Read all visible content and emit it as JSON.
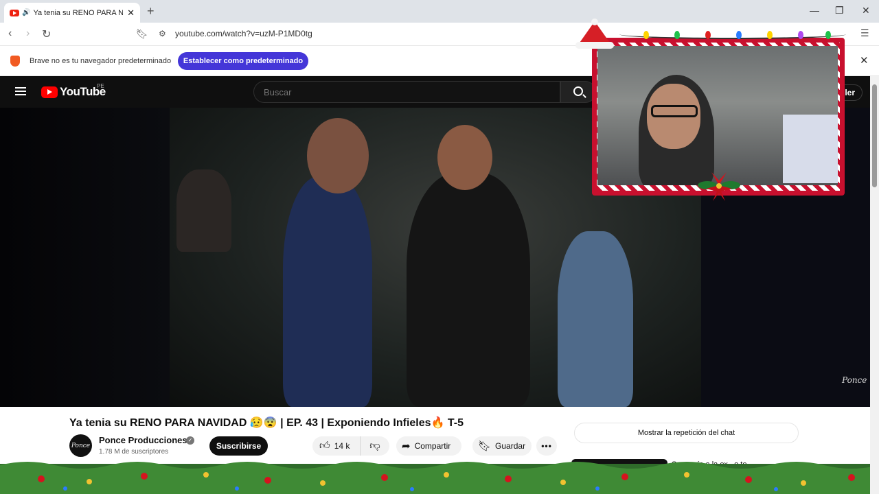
{
  "browser": {
    "tab_title": "Ya tenia su RENO PARA NAVII",
    "url": "youtube.com/watch?v=uzM-P1MD0tg",
    "new_tab_label": "+",
    "controls": {
      "minimize": "—",
      "restore": "❐",
      "close": "✕"
    }
  },
  "infobar": {
    "message": "Brave no es tu navegador predeterminado",
    "button_label": "Establecer como predeterminado",
    "close_label": "✕"
  },
  "youtube": {
    "logo_text": "YouTube",
    "region": "PE",
    "search_placeholder": "Buscar",
    "signin_partial": "ler"
  },
  "video": {
    "watermark": "Ponce",
    "title": "Ya tenia su RENO PARA NAVIDAD 😥😨 | EP. 43 | Exponiendo Infieles🔥 T-5",
    "channel": {
      "name": "Ponce Producciones",
      "avatar_text": "Ponce",
      "subscribers": "1.78 M de suscriptores",
      "verified": "✓"
    },
    "subscribe_label": "Suscribirse",
    "likes": "14 k",
    "share_label": "Compartir",
    "save_label": "Guardar",
    "more_label": "•••"
  },
  "sidebar": {
    "chat_replay_label": "Mostrar la repetición del chat",
    "next_video_title": "Se comía a la ex...o te..."
  },
  "colors": {
    "brave_button": "#4436d8",
    "youtube_red": "#ff0000",
    "header_bg": "#0f0f0f",
    "frame_red": "#c8102e"
  }
}
